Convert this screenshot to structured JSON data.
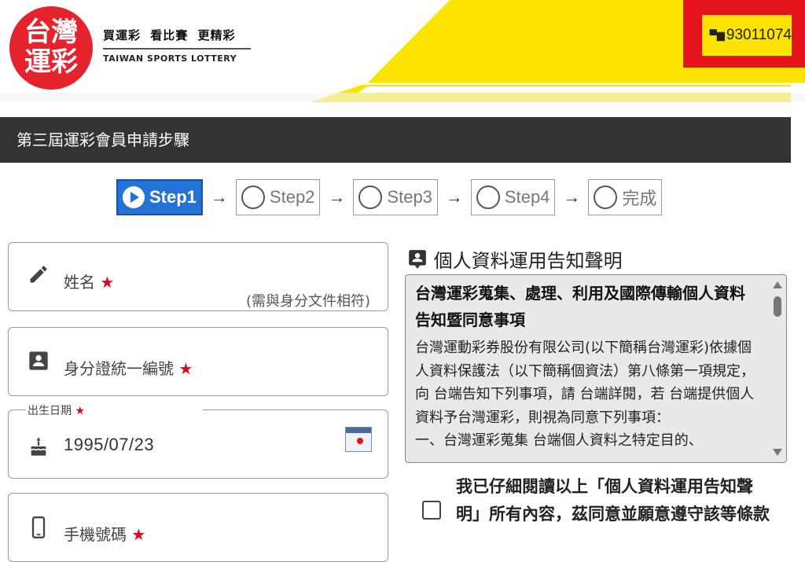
{
  "header": {
    "logo_line1": "台灣",
    "logo_line2": "運彩",
    "tagline_cn": "買運彩 看比賽 更精彩",
    "tagline_en": "TAIWAN SPORTS LOTTERY",
    "member_icon": "store-icon",
    "member_id": "93011074",
    "colors": {
      "brand_red": "#e5232d",
      "yellow": "#fce300",
      "highlight": "#e4141b"
    }
  },
  "title_bar": {
    "text": "第三屆運彩會員申請步驟"
  },
  "steps": [
    {
      "label": "Step1",
      "active": true
    },
    {
      "label": "Step2",
      "active": false
    },
    {
      "label": "Step3",
      "active": false
    },
    {
      "label": "Step4",
      "active": false
    },
    {
      "label": "完成",
      "active": false
    }
  ],
  "step_arrow": "→",
  "form": {
    "name": {
      "icon": "pencil-icon",
      "label": "姓名",
      "required": "★",
      "hint": "(需與身分文件相符)"
    },
    "id_number": {
      "icon": "id-card-icon",
      "label": "身分證統一編號",
      "required": "★"
    },
    "birthday": {
      "icon": "cake-icon",
      "legend": "出生日期",
      "required": "★",
      "value": "1995/07/23",
      "picker_icon": "calendar-icon"
    },
    "mobile": {
      "icon": "mobile-phone-icon",
      "label": "手機號碼",
      "required": "★"
    }
  },
  "notice": {
    "icon": "contact-card-icon",
    "title": "個人資料運用告知聲明",
    "heading": "台灣運彩蒐集、處理、利用及國際傳輸個人資料告知暨同意事項",
    "body": "台灣運動彩券股份有限公司(以下簡稱台灣運彩)依據個人資料保護法（以下簡稱個資法）第八條第一項規定，向 台端告知下列事項，請 台端詳閱，若 台端提供個人資料予台灣運彩，則視為同意下列事項：",
    "body_cont": "一、台灣運彩蒐集 台端個人資料之特定目的、"
  },
  "agreement": {
    "text": "我已仔細閱讀以上「個人資料運用告知聲明」所有內容，茲同意並願意遵守該等條款",
    "checked": false
  }
}
